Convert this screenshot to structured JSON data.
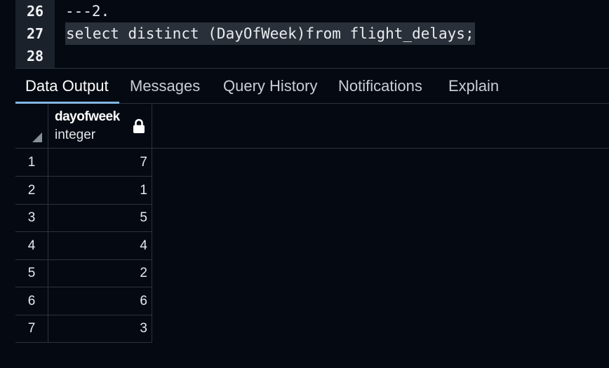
{
  "editor": {
    "lines": [
      {
        "number": "26",
        "code": "---2."
      },
      {
        "number": "27",
        "code": "select distinct (DayOfWeek)from flight_delays;"
      },
      {
        "number": "28",
        "code": ""
      }
    ]
  },
  "tabs": [
    {
      "label": "Data Output",
      "active": true
    },
    {
      "label": "Messages",
      "active": false
    },
    {
      "label": "Query History",
      "active": false
    },
    {
      "label": "Notifications",
      "active": false
    },
    {
      "label": "Explain",
      "active": false
    }
  ],
  "grid": {
    "column": {
      "name": "dayofweek",
      "type": "integer",
      "icon": "lock-icon"
    },
    "rows": [
      {
        "row_number": "1",
        "value": "7"
      },
      {
        "row_number": "2",
        "value": "1"
      },
      {
        "row_number": "3",
        "value": "5"
      },
      {
        "row_number": "4",
        "value": "4"
      },
      {
        "row_number": "5",
        "value": "2"
      },
      {
        "row_number": "6",
        "value": "6"
      },
      {
        "row_number": "7",
        "value": "3"
      }
    ]
  },
  "colors": {
    "background": "#050a12",
    "gutter": "#1b212b",
    "active_tab_underline": "#84b7e3"
  }
}
